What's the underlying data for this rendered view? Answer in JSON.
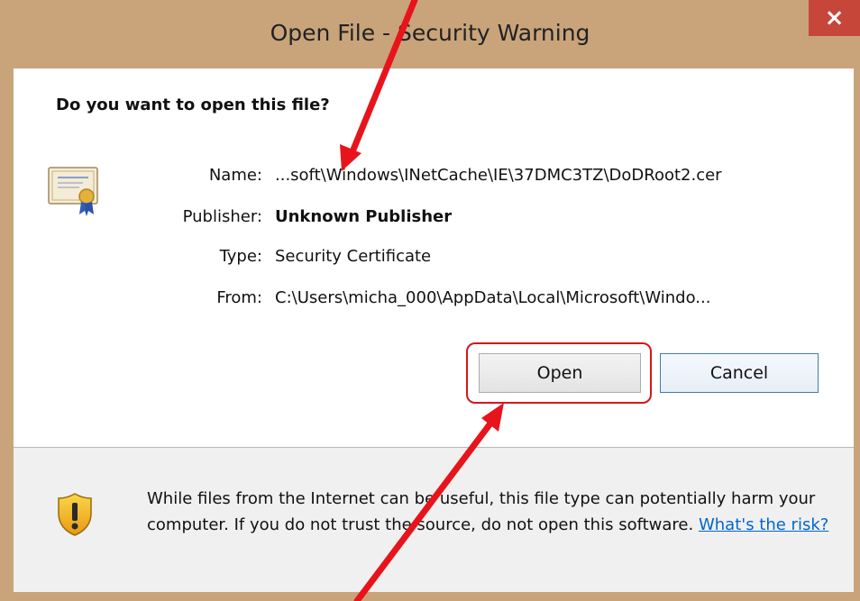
{
  "window": {
    "title": "Open File - Security Warning",
    "close_glyph": "×"
  },
  "dialog": {
    "question": "Do you want to open this file?",
    "fields": {
      "name_label": "Name:",
      "name_value": "...soft\\Windows\\INetCache\\IE\\37DMC3TZ\\DoDRoot2.cer",
      "publisher_label": "Publisher:",
      "publisher_value": "Unknown Publisher",
      "type_label": "Type:",
      "type_value": "Security Certificate",
      "from_label": "From:",
      "from_value": "C:\\Users\\micha_000\\AppData\\Local\\Microsoft\\Windo..."
    },
    "buttons": {
      "open": "Open",
      "cancel": "Cancel"
    },
    "warning": {
      "text": "While files from the Internet can be useful, this file type can potentially harm your computer. If you do not trust the source, do not open this software.",
      "link": "What's the risk?"
    }
  },
  "icons": [
    "certificate-icon",
    "shield-warning-icon",
    "close-icon"
  ],
  "colors": {
    "frame": "#c9a47b",
    "close_button": "#c7463a",
    "annotation": "#e8141b",
    "link": "#0066cc"
  }
}
